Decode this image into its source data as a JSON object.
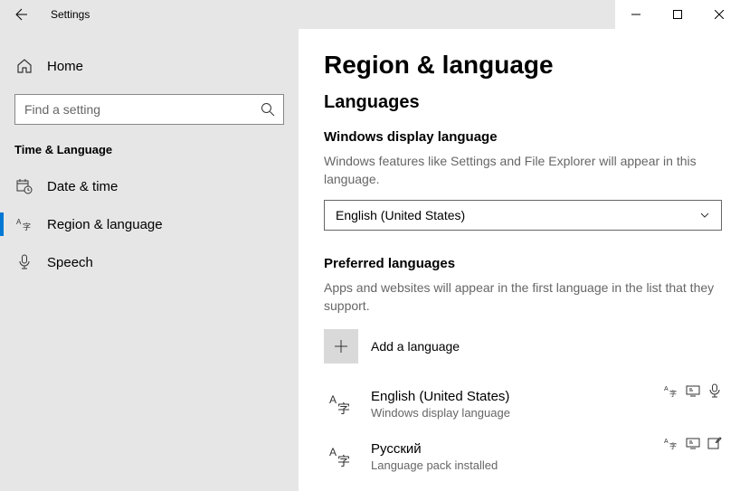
{
  "window": {
    "title": "Settings"
  },
  "sidebar": {
    "home": "Home",
    "search_placeholder": "Find a setting",
    "category": "Time & Language",
    "items": [
      {
        "label": "Date & time"
      },
      {
        "label": "Region & language"
      },
      {
        "label": "Speech"
      }
    ]
  },
  "main": {
    "heading": "Region & language",
    "section": "Languages",
    "display_lang": {
      "title": "Windows display language",
      "desc": "Windows features like Settings and File Explorer will appear in this language.",
      "value": "English (United States)"
    },
    "preferred": {
      "title": "Preferred languages",
      "desc": "Apps and websites will appear in the first language in the list that they support.",
      "add_label": "Add a language",
      "list": [
        {
          "name": "English (United States)",
          "sub": "Windows display language"
        },
        {
          "name": "Русский",
          "sub": "Language pack installed"
        }
      ]
    }
  }
}
